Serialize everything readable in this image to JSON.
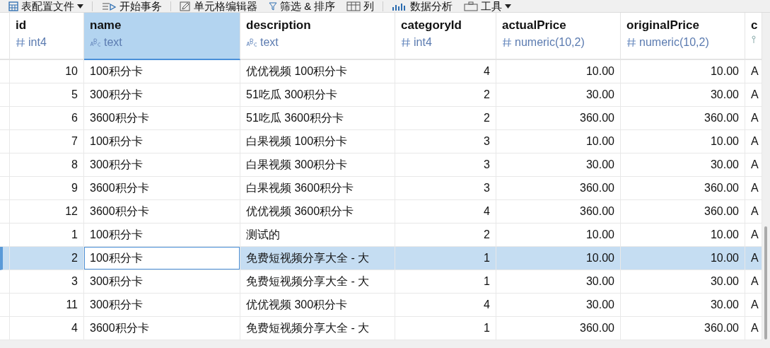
{
  "toolbar": [
    {
      "label": "表配置文件",
      "dropdown": true
    },
    {
      "label": "开始事务",
      "dropdown": false
    },
    {
      "label": "单元格编辑器",
      "dropdown": false
    },
    {
      "label": "筛选 & 排序",
      "dropdown": false
    },
    {
      "label": "列",
      "dropdown": false
    },
    {
      "label": "数据分析",
      "dropdown": false
    },
    {
      "label": "工具",
      "dropdown": true
    }
  ],
  "columns": [
    {
      "name": "id",
      "type": "int4",
      "kind": "number",
      "selected": false
    },
    {
      "name": "name",
      "type": "text",
      "kind": "text",
      "selected": true
    },
    {
      "name": "description",
      "type": "text",
      "kind": "text",
      "selected": false
    },
    {
      "name": "categoryId",
      "type": "int4",
      "kind": "number",
      "selected": false
    },
    {
      "name": "actualPrice",
      "type": "numeric(10,2)",
      "kind": "number",
      "selected": false
    },
    {
      "name": "originalPrice",
      "type": "numeric(10,2)",
      "kind": "number",
      "selected": false
    },
    {
      "name": "c",
      "kind": "other",
      "selected": false
    }
  ],
  "rows": [
    {
      "cells": [
        "10",
        "100积分卡",
        "优优视频 100积分卡",
        "4",
        "10.00",
        "10.00",
        "A"
      ],
      "selected": false
    },
    {
      "cells": [
        "5",
        "300积分卡",
        "51吃瓜 300积分卡",
        "2",
        "30.00",
        "30.00",
        "A"
      ],
      "selected": false
    },
    {
      "cells": [
        "6",
        "3600积分卡",
        "51吃瓜 3600积分卡",
        "2",
        "360.00",
        "360.00",
        "A"
      ],
      "selected": false
    },
    {
      "cells": [
        "7",
        "100积分卡",
        "白果视频 100积分卡",
        "3",
        "10.00",
        "10.00",
        "A"
      ],
      "selected": false
    },
    {
      "cells": [
        "8",
        "300积分卡",
        "白果视频 300积分卡",
        "3",
        "30.00",
        "30.00",
        "A"
      ],
      "selected": false
    },
    {
      "cells": [
        "9",
        "3600积分卡",
        "白果视频 3600积分卡",
        "3",
        "360.00",
        "360.00",
        "A"
      ],
      "selected": false
    },
    {
      "cells": [
        "12",
        "3600积分卡",
        "优优视频 3600积分卡",
        "4",
        "360.00",
        "360.00",
        "A"
      ],
      "selected": false
    },
    {
      "cells": [
        "1",
        "100积分卡",
        "测试的",
        "2",
        "10.00",
        "10.00",
        "A"
      ],
      "selected": false
    },
    {
      "cells": [
        "2",
        "100积分卡",
        "免费短视频分享大全 - 大",
        "1",
        "10.00",
        "10.00",
        "A"
      ],
      "selected": true
    },
    {
      "cells": [
        "3",
        "300积分卡",
        "免费短视频分享大全 - 大",
        "1",
        "30.00",
        "30.00",
        "A"
      ],
      "selected": false
    },
    {
      "cells": [
        "11",
        "300积分卡",
        "优优视频 300积分卡",
        "4",
        "30.00",
        "30.00",
        "A"
      ],
      "selected": false
    },
    {
      "cells": [
        "4",
        "3600积分卡",
        "免费短视频分享大全 - 大",
        "1",
        "360.00",
        "360.00",
        "A"
      ],
      "selected": false
    }
  ]
}
